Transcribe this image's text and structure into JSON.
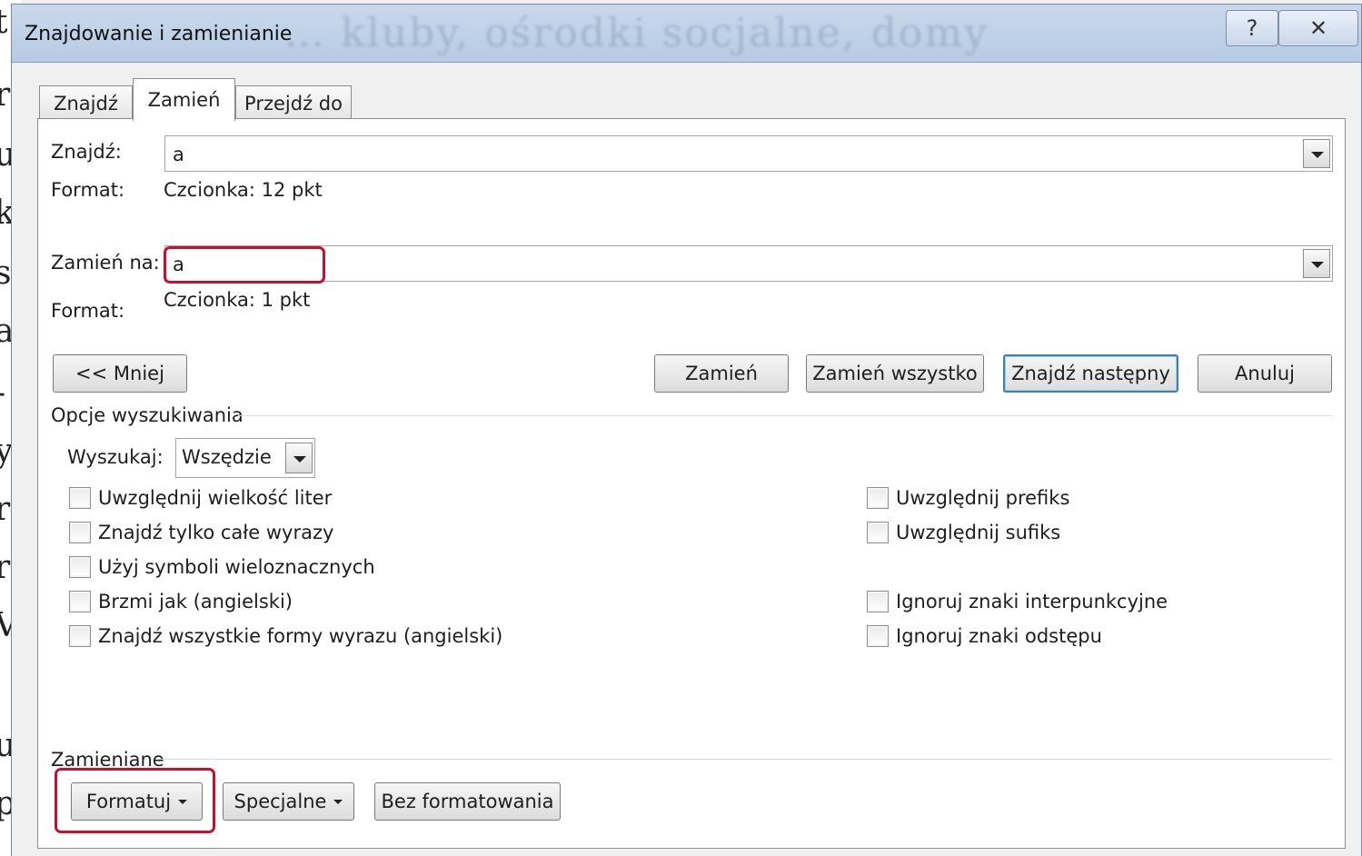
{
  "background_doc": {
    "letters": [
      "t",
      "r",
      "u",
      "k",
      "s",
      "a",
      "-",
      "y",
      "r",
      "r",
      "V",
      "u",
      "p"
    ]
  },
  "window": {
    "title": "Znajdowanie i zamienianie",
    "ghost_text": "… kluby, ośrodki socjalne, domy",
    "help_label": "?",
    "close_label": "✕"
  },
  "tabs": [
    {
      "label": "Znajdź",
      "active": false
    },
    {
      "label": "Zamień",
      "active": true
    },
    {
      "label": "Przejdź do",
      "active": false
    }
  ],
  "find": {
    "label": "Znajdź:",
    "value": "a",
    "format_label": "Format:",
    "format_value": "Czcionka: 12 pkt"
  },
  "replace": {
    "label": "Zamień na:",
    "value": "a",
    "format_label": "Format:",
    "format_value": "Czcionka: 1 pkt"
  },
  "buttons": {
    "less": "<< Mniej",
    "replace": "Zamień",
    "replace_all": "Zamień wszystko",
    "find_next": "Znajdź następny",
    "cancel": "Anuluj"
  },
  "search_options": {
    "title": "Opcje wyszukiwania",
    "search_label": "Wyszukaj:",
    "search_value": "Wszędzie",
    "left_options": [
      "Uwzględnij wielkość liter",
      "Znajdź tylko całe wyrazy",
      "Użyj symboli wieloznacznych",
      "Brzmi jak (angielski)",
      "Znajdź wszystkie formy wyrazu (angielski)"
    ],
    "right_options": [
      "Uwzględnij prefiks",
      "Uwzględnij sufiks",
      "Ignoruj znaki interpunkcyjne",
      "Ignoruj znaki odstępu"
    ]
  },
  "replace_group": {
    "title": "Zamieniane",
    "format_button": "Formatuj",
    "special_button": "Specjalne",
    "no_format_button": "Bez formatowania"
  },
  "colors": {
    "highlight": "#c8102e",
    "default_button_border": "#3c7fb1"
  }
}
